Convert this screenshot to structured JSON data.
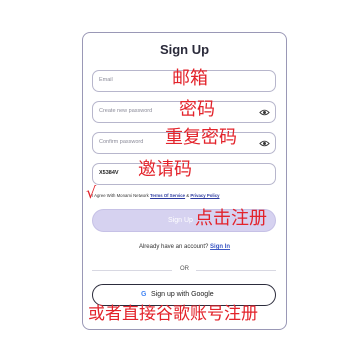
{
  "form": {
    "title": "Sign Up",
    "email_placeholder": "Email",
    "password_placeholder": "Create new password",
    "confirm_placeholder": "Confirm password",
    "invite_code_value": "X5384V",
    "terms_prefix": "I Agree With Monami Network",
    "terms_link": "Terms Of Service",
    "terms_and": "&",
    "privacy_link": "Privacy Policy",
    "signup_label": "Sign Up",
    "already_text": "Already have an account?",
    "signin_link": "Sign In",
    "or_text": "OR",
    "google_label": "Sign up with Google",
    "google_glyph": "G"
  },
  "annotations": {
    "email": "邮箱",
    "password": "密码",
    "confirm": "重复密码",
    "invite": "邀请码",
    "check": "√",
    "click_signup": "点击注册",
    "google_hint": "或者直接谷歌账号注册"
  },
  "colors": {
    "annotation": "#e3232b",
    "button_disabled": "#d6d2f0",
    "link": "#3b57c4"
  }
}
